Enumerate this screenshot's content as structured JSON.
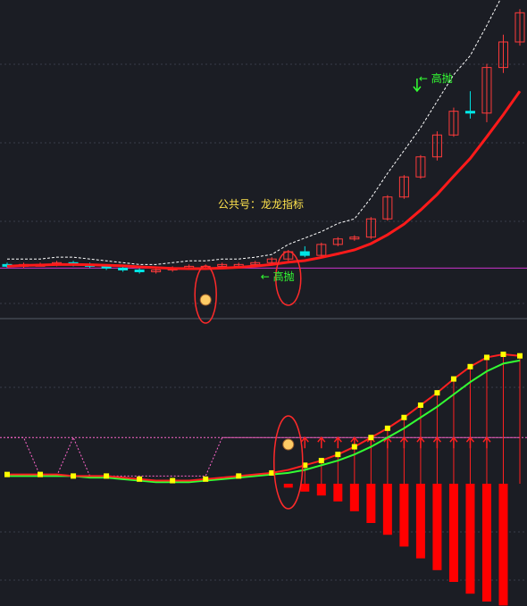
{
  "chart_data": [
    {
      "type": "candlestick",
      "panel": "main",
      "title": "",
      "annotation_wechat": "公共号：龙龙指标",
      "signal_text": "高抛",
      "flat_line_color": "#cc33cc",
      "ma_color": "#ff1a1a",
      "dash_line_color": "#ffffff",
      "up_color": "#ff3b3b",
      "down_color": "#00e5e5",
      "candles": [
        {
          "o": 40,
          "h": 41,
          "l": 38,
          "c": 39
        },
        {
          "o": 39,
          "h": 41,
          "l": 38,
          "c": 40
        },
        {
          "o": 40,
          "h": 41,
          "l": 39,
          "c": 40
        },
        {
          "o": 40,
          "h": 42,
          "l": 39,
          "c": 41
        },
        {
          "o": 41,
          "h": 42,
          "l": 39,
          "c": 40
        },
        {
          "o": 40,
          "h": 41,
          "l": 38,
          "c": 39
        },
        {
          "o": 39,
          "h": 40,
          "l": 37,
          "c": 38
        },
        {
          "o": 38,
          "h": 39,
          "l": 36,
          "c": 37
        },
        {
          "o": 37,
          "h": 38,
          "l": 35,
          "c": 36
        },
        {
          "o": 36,
          "h": 38,
          "l": 35,
          "c": 37
        },
        {
          "o": 37,
          "h": 39,
          "l": 36,
          "c": 38
        },
        {
          "o": 38,
          "h": 40,
          "l": 37,
          "c": 39
        },
        {
          "o": 39,
          "h": 40,
          "l": 38,
          "c": 39
        },
        {
          "o": 39,
          "h": 41,
          "l": 38,
          "c": 40
        },
        {
          "o": 40,
          "h": 41,
          "l": 38,
          "c": 40
        },
        {
          "o": 40,
          "h": 42,
          "l": 39,
          "c": 41
        },
        {
          "o": 41,
          "h": 44,
          "l": 40,
          "c": 43
        },
        {
          "o": 43,
          "h": 48,
          "l": 42,
          "c": 47
        },
        {
          "o": 47,
          "h": 50,
          "l": 44,
          "c": 45
        },
        {
          "o": 45,
          "h": 52,
          "l": 44,
          "c": 51
        },
        {
          "o": 51,
          "h": 55,
          "l": 50,
          "c": 54
        },
        {
          "o": 54,
          "h": 56,
          "l": 53,
          "c": 55
        },
        {
          "o": 55,
          "h": 66,
          "l": 54,
          "c": 65
        },
        {
          "o": 65,
          "h": 78,
          "l": 64,
          "c": 77
        },
        {
          "o": 77,
          "h": 89,
          "l": 76,
          "c": 88
        },
        {
          "o": 88,
          "h": 100,
          "l": 87,
          "c": 99
        },
        {
          "o": 99,
          "h": 113,
          "l": 97,
          "c": 111
        },
        {
          "o": 111,
          "h": 126,
          "l": 110,
          "c": 124
        },
        {
          "o": 124,
          "h": 135,
          "l": 120,
          "c": 123
        },
        {
          "o": 123,
          "h": 150,
          "l": 118,
          "c": 148
        },
        {
          "o": 148,
          "h": 166,
          "l": 145,
          "c": 162
        },
        {
          "o": 162,
          "h": 180,
          "l": 160,
          "c": 178
        }
      ],
      "ylim": [
        25,
        185
      ]
    },
    {
      "type": "line",
      "panel": "indicator",
      "title": "",
      "threshold": 80,
      "threshold_color": "#ff66cc",
      "fast_line_color": "#ff2020",
      "slow_line_color": "#33ff33",
      "marker_color": "#ffff00",
      "bar_color": "#ff0000",
      "arrow_color": "#ff2020",
      "fast": [
        56,
        56,
        56,
        56,
        55,
        55,
        55,
        54,
        53,
        52,
        52,
        52,
        53,
        54,
        55,
        56,
        57,
        59,
        62,
        65,
        69,
        74,
        80,
        86,
        93,
        101,
        109,
        118,
        126,
        132,
        134,
        133
      ],
      "slow": [
        55,
        55,
        55,
        55,
        55,
        54,
        54,
        53,
        52,
        51,
        51,
        51,
        52,
        53,
        54,
        55,
        56,
        57,
        59,
        62,
        65,
        69,
        74,
        80,
        86,
        93,
        100,
        108,
        116,
        123,
        128,
        130
      ],
      "pink": [
        80,
        80,
        55,
        55,
        80,
        55,
        55,
        55,
        55,
        55,
        55,
        55,
        55,
        80,
        80,
        80,
        80,
        80,
        80,
        80,
        80,
        80,
        80,
        80,
        80,
        80,
        80,
        80,
        80,
        80,
        80,
        80
      ],
      "bars": [
        0,
        0,
        0,
        0,
        0,
        0,
        0,
        0,
        0,
        0,
        0,
        0,
        0,
        0,
        0,
        0,
        0,
        2,
        4,
        6,
        9,
        14,
        20,
        26,
        32,
        38,
        44,
        50,
        56,
        60,
        62,
        0
      ],
      "arrows_from": 18,
      "ylim": [
        0,
        145
      ]
    }
  ]
}
